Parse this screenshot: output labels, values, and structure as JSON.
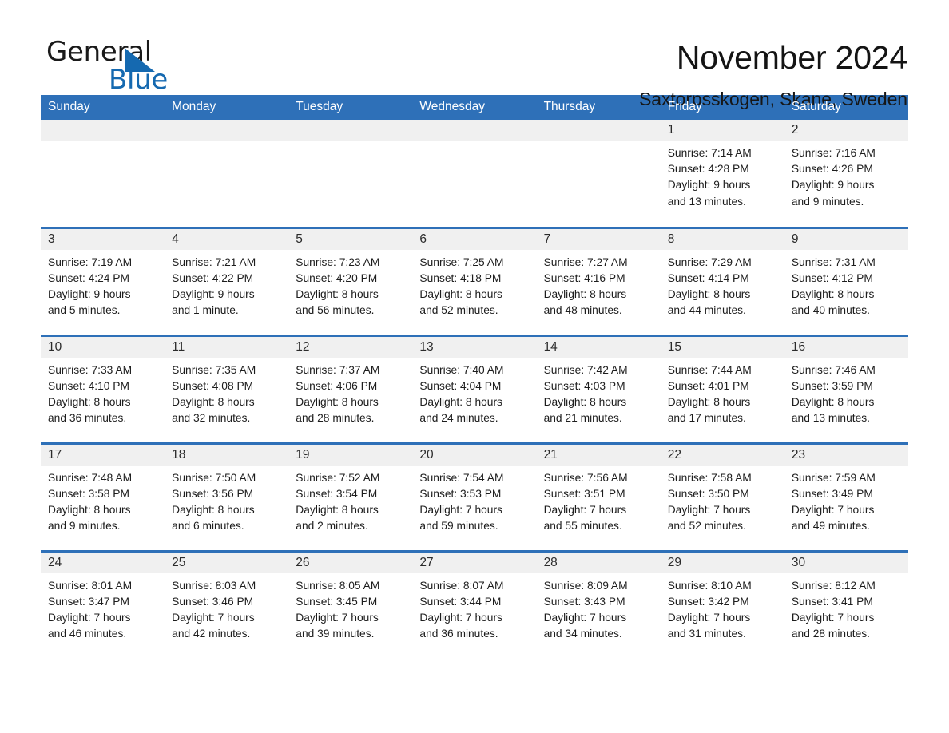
{
  "logo": {
    "word1": "General",
    "word2": "Blue",
    "triangle_color": "#1569b0"
  },
  "header": {
    "month_title": "November 2024",
    "location": "Saxtorpsskogen, Skane, Sweden",
    "accent_color": "#2e70b8"
  },
  "calendar": {
    "weekday_headers": [
      "Sunday",
      "Monday",
      "Tuesday",
      "Wednesday",
      "Thursday",
      "Friday",
      "Saturday"
    ],
    "weeks": [
      [
        {
          "day": "",
          "lines": []
        },
        {
          "day": "",
          "lines": []
        },
        {
          "day": "",
          "lines": []
        },
        {
          "day": "",
          "lines": []
        },
        {
          "day": "",
          "lines": []
        },
        {
          "day": "1",
          "lines": [
            "Sunrise: 7:14 AM",
            "Sunset: 4:28 PM",
            "Daylight: 9 hours",
            "and 13 minutes."
          ]
        },
        {
          "day": "2",
          "lines": [
            "Sunrise: 7:16 AM",
            "Sunset: 4:26 PM",
            "Daylight: 9 hours",
            "and 9 minutes."
          ]
        }
      ],
      [
        {
          "day": "3",
          "lines": [
            "Sunrise: 7:19 AM",
            "Sunset: 4:24 PM",
            "Daylight: 9 hours",
            "and 5 minutes."
          ]
        },
        {
          "day": "4",
          "lines": [
            "Sunrise: 7:21 AM",
            "Sunset: 4:22 PM",
            "Daylight: 9 hours",
            "and 1 minute."
          ]
        },
        {
          "day": "5",
          "lines": [
            "Sunrise: 7:23 AM",
            "Sunset: 4:20 PM",
            "Daylight: 8 hours",
            "and 56 minutes."
          ]
        },
        {
          "day": "6",
          "lines": [
            "Sunrise: 7:25 AM",
            "Sunset: 4:18 PM",
            "Daylight: 8 hours",
            "and 52 minutes."
          ]
        },
        {
          "day": "7",
          "lines": [
            "Sunrise: 7:27 AM",
            "Sunset: 4:16 PM",
            "Daylight: 8 hours",
            "and 48 minutes."
          ]
        },
        {
          "day": "8",
          "lines": [
            "Sunrise: 7:29 AM",
            "Sunset: 4:14 PM",
            "Daylight: 8 hours",
            "and 44 minutes."
          ]
        },
        {
          "day": "9",
          "lines": [
            "Sunrise: 7:31 AM",
            "Sunset: 4:12 PM",
            "Daylight: 8 hours",
            "and 40 minutes."
          ]
        }
      ],
      [
        {
          "day": "10",
          "lines": [
            "Sunrise: 7:33 AM",
            "Sunset: 4:10 PM",
            "Daylight: 8 hours",
            "and 36 minutes."
          ]
        },
        {
          "day": "11",
          "lines": [
            "Sunrise: 7:35 AM",
            "Sunset: 4:08 PM",
            "Daylight: 8 hours",
            "and 32 minutes."
          ]
        },
        {
          "day": "12",
          "lines": [
            "Sunrise: 7:37 AM",
            "Sunset: 4:06 PM",
            "Daylight: 8 hours",
            "and 28 minutes."
          ]
        },
        {
          "day": "13",
          "lines": [
            "Sunrise: 7:40 AM",
            "Sunset: 4:04 PM",
            "Daylight: 8 hours",
            "and 24 minutes."
          ]
        },
        {
          "day": "14",
          "lines": [
            "Sunrise: 7:42 AM",
            "Sunset: 4:03 PM",
            "Daylight: 8 hours",
            "and 21 minutes."
          ]
        },
        {
          "day": "15",
          "lines": [
            "Sunrise: 7:44 AM",
            "Sunset: 4:01 PM",
            "Daylight: 8 hours",
            "and 17 minutes."
          ]
        },
        {
          "day": "16",
          "lines": [
            "Sunrise: 7:46 AM",
            "Sunset: 3:59 PM",
            "Daylight: 8 hours",
            "and 13 minutes."
          ]
        }
      ],
      [
        {
          "day": "17",
          "lines": [
            "Sunrise: 7:48 AM",
            "Sunset: 3:58 PM",
            "Daylight: 8 hours",
            "and 9 minutes."
          ]
        },
        {
          "day": "18",
          "lines": [
            "Sunrise: 7:50 AM",
            "Sunset: 3:56 PM",
            "Daylight: 8 hours",
            "and 6 minutes."
          ]
        },
        {
          "day": "19",
          "lines": [
            "Sunrise: 7:52 AM",
            "Sunset: 3:54 PM",
            "Daylight: 8 hours",
            "and 2 minutes."
          ]
        },
        {
          "day": "20",
          "lines": [
            "Sunrise: 7:54 AM",
            "Sunset: 3:53 PM",
            "Daylight: 7 hours",
            "and 59 minutes."
          ]
        },
        {
          "day": "21",
          "lines": [
            "Sunrise: 7:56 AM",
            "Sunset: 3:51 PM",
            "Daylight: 7 hours",
            "and 55 minutes."
          ]
        },
        {
          "day": "22",
          "lines": [
            "Sunrise: 7:58 AM",
            "Sunset: 3:50 PM",
            "Daylight: 7 hours",
            "and 52 minutes."
          ]
        },
        {
          "day": "23",
          "lines": [
            "Sunrise: 7:59 AM",
            "Sunset: 3:49 PM",
            "Daylight: 7 hours",
            "and 49 minutes."
          ]
        }
      ],
      [
        {
          "day": "24",
          "lines": [
            "Sunrise: 8:01 AM",
            "Sunset: 3:47 PM",
            "Daylight: 7 hours",
            "and 46 minutes."
          ]
        },
        {
          "day": "25",
          "lines": [
            "Sunrise: 8:03 AM",
            "Sunset: 3:46 PM",
            "Daylight: 7 hours",
            "and 42 minutes."
          ]
        },
        {
          "day": "26",
          "lines": [
            "Sunrise: 8:05 AM",
            "Sunset: 3:45 PM",
            "Daylight: 7 hours",
            "and 39 minutes."
          ]
        },
        {
          "day": "27",
          "lines": [
            "Sunrise: 8:07 AM",
            "Sunset: 3:44 PM",
            "Daylight: 7 hours",
            "and 36 minutes."
          ]
        },
        {
          "day": "28",
          "lines": [
            "Sunrise: 8:09 AM",
            "Sunset: 3:43 PM",
            "Daylight: 7 hours",
            "and 34 minutes."
          ]
        },
        {
          "day": "29",
          "lines": [
            "Sunrise: 8:10 AM",
            "Sunset: 3:42 PM",
            "Daylight: 7 hours",
            "and 31 minutes."
          ]
        },
        {
          "day": "30",
          "lines": [
            "Sunrise: 8:12 AM",
            "Sunset: 3:41 PM",
            "Daylight: 7 hours",
            "and 28 minutes."
          ]
        }
      ]
    ]
  }
}
